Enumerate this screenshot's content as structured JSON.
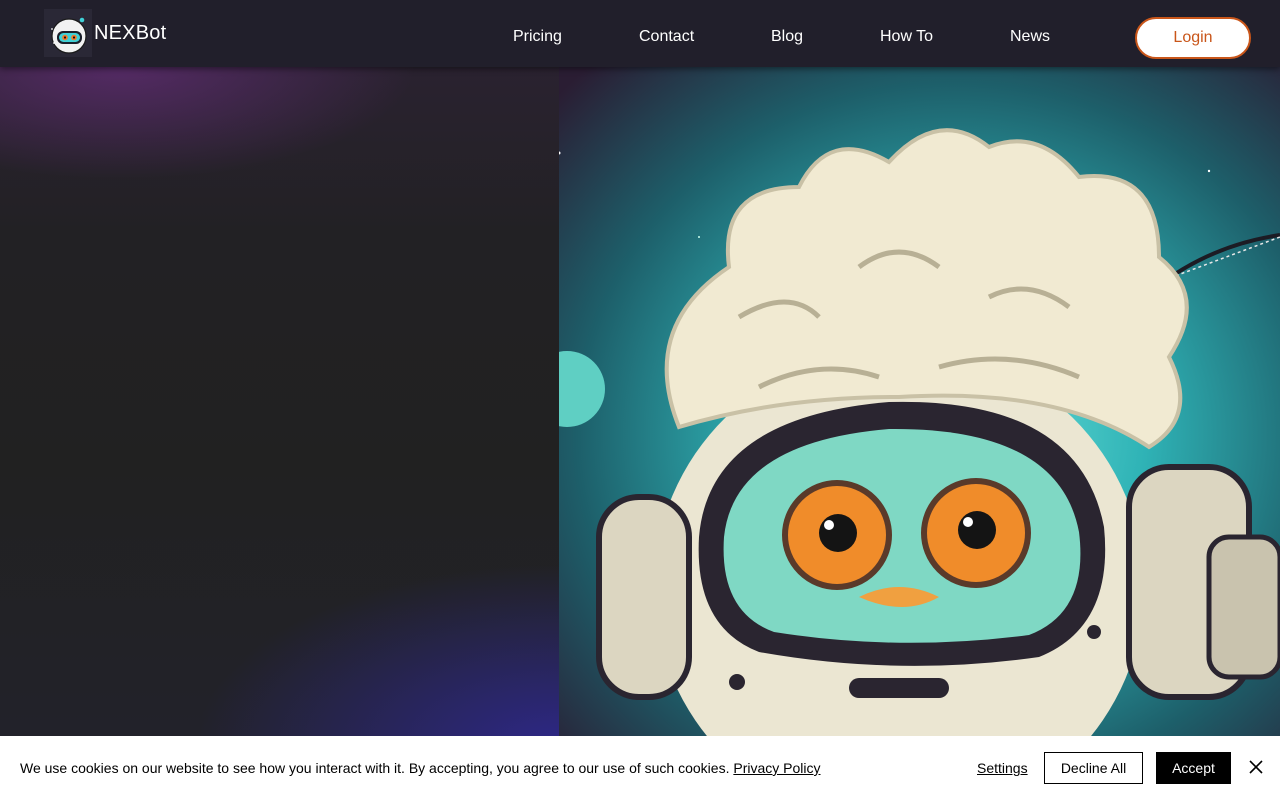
{
  "header": {
    "brand_name": "NEXBot",
    "nav": [
      "Pricing",
      "Contact",
      "Blog",
      "How To",
      "News"
    ],
    "login_label": "Login"
  },
  "hero": {
    "image_icon": "astronaut-owl-illustration"
  },
  "cookie_banner": {
    "message": "We use cookies on our website to see how you interact with it. By accepting, you agree to our use of such cookies.",
    "privacy_link": "Privacy Policy",
    "settings_label": "Settings",
    "decline_label": "Decline All",
    "accept_label": "Accept",
    "close_icon": "close-icon"
  },
  "colors": {
    "header_bg": "#211f2b",
    "accent": "#c9561a",
    "page_bg": "#1f1f1f"
  }
}
